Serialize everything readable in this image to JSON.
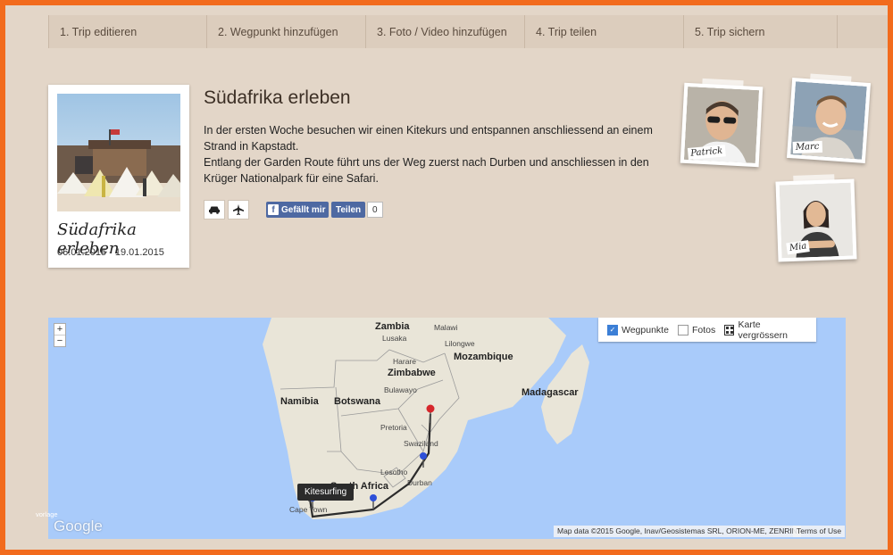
{
  "nav": {
    "steps": [
      "1. Trip editieren",
      "2. Wegpunkt hinzufügen",
      "3. Foto / Video hinzufügen",
      "4. Trip teilen",
      "5. Trip sichern"
    ]
  },
  "trip": {
    "card_title": "Südafrika erleben",
    "dates": "06.01.2015 - 19.01.2015",
    "title": "Südafrika erleben",
    "description": [
      "In der ersten Woche besuchen wir einen Kitekurs und entspannen anschliessend an einem Strand in Kapstadt.",
      "Entlang der Garden Route führt uns der Weg zuerst nach Durben und anschliessen in den Krüger Nationalpark für eine Safari."
    ],
    "transport_icons": [
      "car-icon",
      "plane-icon"
    ]
  },
  "social": {
    "like_label": "Gefällt mir",
    "share_label": "Teilen",
    "count": "0",
    "brand_color": "#4e69a2"
  },
  "team": [
    "Patrick",
    "Marc",
    "Mia"
  ],
  "map": {
    "zoom_in": "+",
    "zoom_out": "−",
    "controls": {
      "waypoints_label": "Wegpunkte",
      "waypoints_checked": true,
      "photos_label": "Fotos",
      "photos_checked": false,
      "enlarge_label": "Karte vergrössern"
    },
    "tooltip": "Kitesurfing",
    "attribution": "Map data ©2015 Google, Inav/Geosistemas SRL, ORION-ME, ZENRIN",
    "terms": "Terms of Use",
    "logo": "Google",
    "watermark": "vorlage",
    "labels": {
      "zambia": "Zambia",
      "malawi": "Malawi",
      "lusaka": "Lusaka",
      "lilongwe": "Lilongwe",
      "harare": "Harare",
      "zimbabwe": "Zimbabwe",
      "mozambique": "Mozambique",
      "bulawayo": "Bulawayo",
      "madagascar": "Madagascar",
      "namibia": "Namibia",
      "botswana": "Botswana",
      "pretoria": "Pretoria",
      "swaziland": "Swaziland",
      "lesotho": "Lesotho",
      "south_africa": "South Africa",
      "durban": "Durban",
      "cape_town": "Cape Town"
    },
    "colors": {
      "water": "#a9cbfa",
      "land": "#e9e5d8",
      "route": "#2b2b2b",
      "marker_red": "#d6262b",
      "marker_blue": "#2d4fd8",
      "marker_orange": "#f0a22a"
    }
  }
}
